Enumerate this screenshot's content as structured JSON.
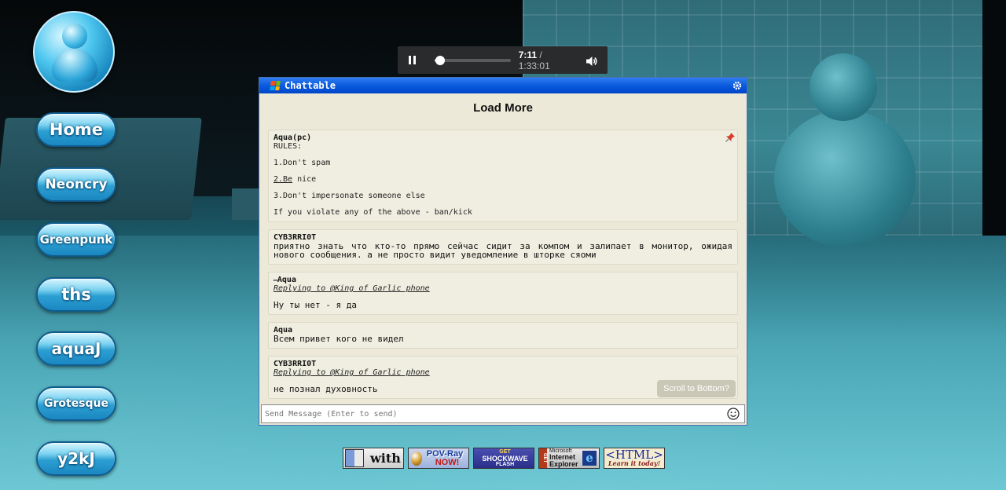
{
  "nav": {
    "items": [
      {
        "label": "Home"
      },
      {
        "label": "Neoncry"
      },
      {
        "label": "Greenpunk"
      },
      {
        "label": "ths"
      },
      {
        "label": "aquaJ"
      },
      {
        "label": "Grotesque"
      },
      {
        "label": "y2kJ"
      }
    ]
  },
  "player": {
    "current_time": "7:11",
    "separator": " / ",
    "duration": "1:33:01",
    "progress_fraction": 0.077
  },
  "chat": {
    "title": "Chattable",
    "load_more": "Load More",
    "messages": [
      {
        "author": "Aqua(pc)",
        "rules_heading": "RULES:",
        "rules": [
          "1.Don't spam",
          "2.Be nice",
          "3.Don't impersonate someone else",
          "If you violate any of the above - ban/kick"
        ],
        "rules_link": "2.Be",
        "rules_link_rest": " nice"
      },
      {
        "author": "CYB3RRI0T",
        "text": "приятно знать что кто-то прямо сейчас сидит за компом и залипает в монитор, ожидая нового сообщения. а не просто видит уведомление в шторке сяоми"
      },
      {
        "author_prefix": "▭",
        "author": "Aqua",
        "reply": "Replying to @King of Garlic phone",
        "text": "Ну ты нет - я да"
      },
      {
        "author": "Aqua",
        "text": "Всем привет кого не видел"
      },
      {
        "author": "CYB3RRI0T",
        "reply": "Replying to @King of Garlic phone",
        "text": "не познал духовность"
      }
    ],
    "scroll_to_bottom": "Scroll to Bottom?",
    "composer_placeholder": "Send Message (Enter to send)"
  },
  "badges": {
    "mac": {
      "text": "with"
    },
    "povray": {
      "line1": "POV-Ray",
      "line2": "NOW!"
    },
    "flash": {
      "line1": "GET",
      "line2": "SHOCKWAVE",
      "line3": "FLASH"
    },
    "ie": {
      "side": "GET",
      "line1": "Microsoft",
      "line2": "Internet",
      "line3": "Explorer",
      "logo": "e"
    },
    "html": {
      "line1": "<HTML>",
      "line2": "Learn it today!"
    }
  },
  "colors": {
    "title_bar": "#0a5adf",
    "chat_bg": "#ece9d8",
    "nav_button": "#2c9fd2"
  }
}
